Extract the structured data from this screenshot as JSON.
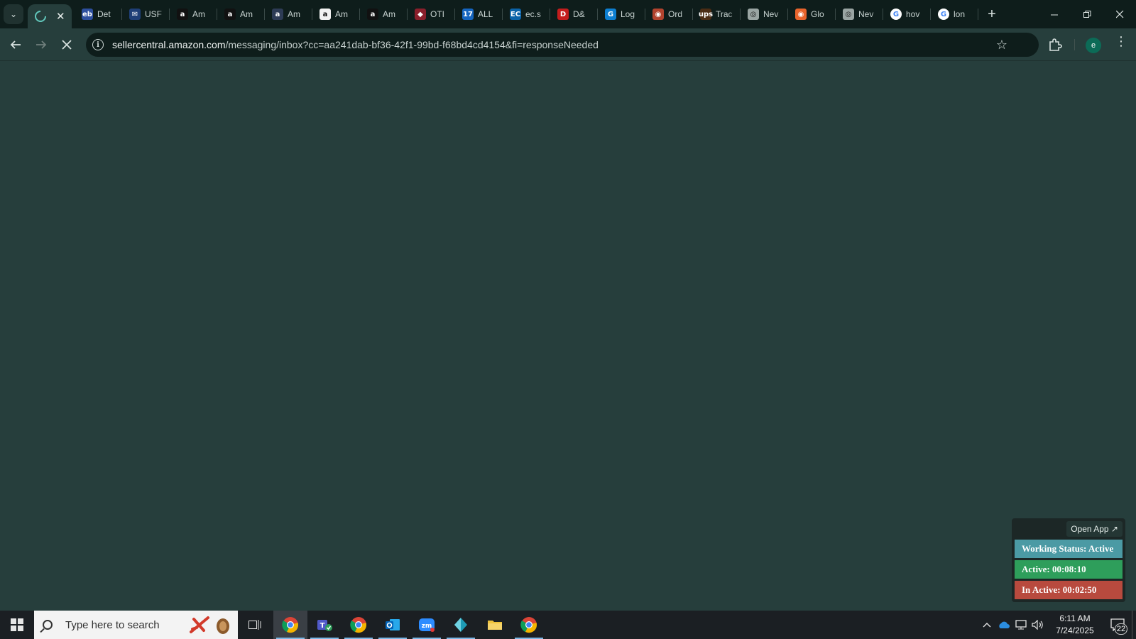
{
  "browser": {
    "active_tab": {
      "icon": "loading-spinner-icon",
      "close_label": "✕"
    },
    "tabs": [
      {
        "title": "Det",
        "icon": "eddie-bauer-icon",
        "color": "#2d4f9e",
        "glyph": "eb"
      },
      {
        "title": "USF",
        "icon": "usps-icon",
        "color": "#1f3f77",
        "glyph": "✉"
      },
      {
        "title": "Am",
        "icon": "amazon-icon",
        "color": "#111111",
        "glyph": "a"
      },
      {
        "title": "Am",
        "icon": "amazon-icon",
        "color": "#111111",
        "glyph": "a"
      },
      {
        "title": "Am",
        "icon": "amazon-seller-icon",
        "color": "#2d3b55",
        "glyph": "a"
      },
      {
        "title": "Am",
        "icon": "amazon-icon",
        "color": "#f2f2f2",
        "glyph": "a"
      },
      {
        "title": "Am",
        "icon": "amazon-icon",
        "color": "#111111",
        "glyph": "a"
      },
      {
        "title": "OTI",
        "icon": "oti-icon",
        "color": "#8a1f2b",
        "glyph": "◆"
      },
      {
        "title": "ALL",
        "icon": "17track-icon",
        "color": "#1565c0",
        "glyph": "17"
      },
      {
        "title": "ec.s",
        "icon": "ec-icon",
        "color": "#0b63a8",
        "glyph": "EC"
      },
      {
        "title": "D&",
        "icon": "dandb-icon",
        "color": "#c41d1d",
        "glyph": "D"
      },
      {
        "title": "Log",
        "icon": "logistics-icon",
        "color": "#0d7fd1",
        "glyph": "G"
      },
      {
        "title": "Ord",
        "icon": "order-icon",
        "color": "#b2432e",
        "glyph": "◉"
      },
      {
        "title": "Trac",
        "icon": "ups-icon",
        "color": "#4a2c14",
        "glyph": "ups"
      },
      {
        "title": "Nev",
        "icon": "chrome-gray-icon",
        "color": "#9aa5a3",
        "glyph": "◎"
      },
      {
        "title": "Glo",
        "icon": "globe-icon",
        "color": "#e8642c",
        "glyph": "◉"
      },
      {
        "title": "Nev",
        "icon": "chrome-gray-icon",
        "color": "#9aa5a3",
        "glyph": "◎"
      },
      {
        "title": "hov",
        "icon": "google-icon",
        "color": "#ffffff",
        "glyph": "G"
      },
      {
        "title": "lon",
        "icon": "google-icon",
        "color": "#ffffff",
        "glyph": "G"
      }
    ],
    "url_host": "sellercentral.amazon.com",
    "url_path": "/messaging/inbox?cc=aa241dab-bf36-42f1-99bd-f68bd4cd4154&fi=responseNeeded",
    "profile_initial": "e"
  },
  "widget": {
    "open_app_label": "Open App ↗",
    "working_status": "Working Status: Active",
    "active": "Active: 00:08:10",
    "inactive": "In Active: 00:02:50",
    "colors": {
      "working": "#4b9aa4",
      "active": "#2e9e5b",
      "inactive": "#b84a3e"
    }
  },
  "taskbar": {
    "search_placeholder": "Type here to search",
    "apps": [
      {
        "name": "chrome-profile-app",
        "icon": "chrome-icon",
        "running": true,
        "focused": true
      },
      {
        "name": "teams-app",
        "icon": "teams-icon",
        "running": true
      },
      {
        "name": "chrome-app",
        "icon": "chrome-icon",
        "running": true
      },
      {
        "name": "outlook-app",
        "icon": "outlook-icon",
        "running": true
      },
      {
        "name": "zoom-app",
        "icon": "zoom-icon",
        "running": true
      },
      {
        "name": "teal-app",
        "icon": "diamond-icon",
        "running": true
      },
      {
        "name": "file-explorer-app",
        "icon": "folder-icon",
        "running": false
      },
      {
        "name": "chrome-app-2",
        "icon": "chrome-icon",
        "running": true
      }
    ],
    "time": "6:11 AM",
    "date": "7/24/2025",
    "notification_count": "22"
  }
}
